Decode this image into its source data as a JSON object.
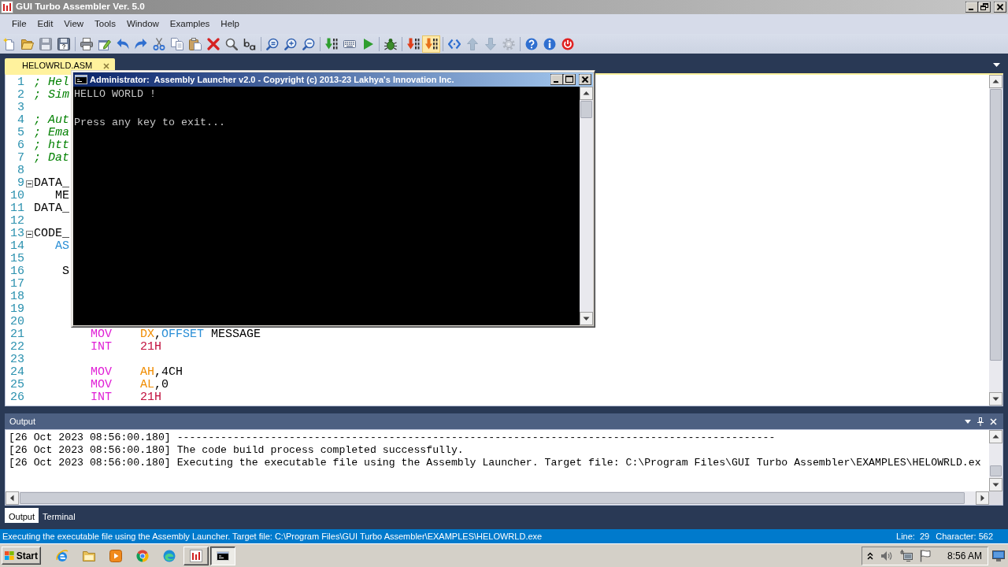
{
  "window": {
    "title": "GUI Turbo Assembler Ver. 5.0"
  },
  "menu": [
    "File",
    "Edit",
    "View",
    "Tools",
    "Window",
    "Examples",
    "Help"
  ],
  "toolbar": [
    [
      {
        "kind": "new",
        "disabled": false,
        "pressed": false
      },
      {
        "kind": "open",
        "disabled": false,
        "pressed": false
      },
      {
        "kind": "save",
        "disabled": true,
        "pressed": false
      },
      {
        "kind": "saveall",
        "disabled": false,
        "pressed": false
      }
    ],
    [
      {
        "kind": "print",
        "disabled": false,
        "pressed": false
      },
      {
        "kind": "publish",
        "disabled": false,
        "pressed": false
      },
      {
        "kind": "undo",
        "disabled": false,
        "pressed": false
      },
      {
        "kind": "redo",
        "disabled": false,
        "pressed": false
      },
      {
        "kind": "cut",
        "disabled": false,
        "pressed": false
      },
      {
        "kind": "copy",
        "disabled": false,
        "pressed": false
      },
      {
        "kind": "paste",
        "disabled": false,
        "pressed": false
      },
      {
        "kind": "delete",
        "disabled": false,
        "pressed": false
      },
      {
        "kind": "find",
        "disabled": false,
        "pressed": false
      },
      {
        "kind": "replace",
        "disabled": false,
        "pressed": false
      }
    ],
    [
      {
        "kind": "zoom",
        "disabled": false,
        "pressed": false
      },
      {
        "kind": "zoomin",
        "disabled": false,
        "pressed": false
      },
      {
        "kind": "zoomout",
        "disabled": false,
        "pressed": false
      }
    ],
    [
      {
        "kind": "build",
        "disabled": false,
        "pressed": false
      },
      {
        "kind": "keyboard",
        "disabled": false,
        "pressed": false
      },
      {
        "kind": "run",
        "disabled": false,
        "pressed": false
      }
    ],
    [
      {
        "kind": "debug",
        "disabled": false,
        "pressed": false
      }
    ],
    [
      {
        "kind": "assemble",
        "disabled": false,
        "pressed": false
      },
      {
        "kind": "link",
        "disabled": false,
        "pressed": true
      }
    ],
    [
      {
        "kind": "code",
        "disabled": false,
        "pressed": false
      },
      {
        "kind": "up",
        "disabled": true,
        "pressed": false
      },
      {
        "kind": "down",
        "disabled": true,
        "pressed": false
      },
      {
        "kind": "settings",
        "disabled": true,
        "pressed": false
      }
    ],
    [
      {
        "kind": "help",
        "disabled": false,
        "pressed": false
      },
      {
        "kind": "info",
        "disabled": false,
        "pressed": false
      },
      {
        "kind": "power",
        "disabled": false,
        "pressed": false
      }
    ]
  ],
  "document_tabs": [
    {
      "label": "HELOWRLD.ASM",
      "selected": true
    }
  ],
  "editor": {
    "lines": [
      {
        "number": "1",
        "segments": [
          {
            "text": "; Hel",
            "kind": "comment"
          }
        ]
      },
      {
        "number": "2",
        "segments": [
          {
            "text": "; Sim",
            "kind": "comment"
          }
        ]
      },
      {
        "number": "3"
      },
      {
        "number": "4",
        "segments": [
          {
            "text": "; Aut",
            "kind": "comment"
          }
        ]
      },
      {
        "number": "5",
        "segments": [
          {
            "text": "; Ema",
            "kind": "comment"
          }
        ]
      },
      {
        "number": "6",
        "segments": [
          {
            "text": "; htt",
            "kind": "comment"
          }
        ]
      },
      {
        "number": "7",
        "segments": [
          {
            "text": "; Dat",
            "kind": "comment"
          }
        ]
      },
      {
        "number": "8"
      },
      {
        "number": "9",
        "expanded": true,
        "segments": [
          {
            "text": "DATA_",
            "kind": "plain"
          }
        ]
      },
      {
        "number": "10",
        "segments": [
          {
            "text": "   ME",
            "kind": "plain"
          }
        ]
      },
      {
        "number": "11",
        "segments": [
          {
            "text": "DATA_",
            "kind": "plain"
          }
        ]
      },
      {
        "number": "12"
      },
      {
        "number": "13",
        "expanded": true,
        "segments": [
          {
            "text": "CODE_",
            "kind": "plain"
          }
        ]
      },
      {
        "number": "14",
        "segments": [
          {
            "text": "   AS",
            "kind": "directive"
          }
        ]
      },
      {
        "number": "15"
      },
      {
        "number": "16",
        "segments": [
          {
            "text": "    S",
            "kind": "plain"
          }
        ]
      },
      {
        "number": "17"
      },
      {
        "number": "18"
      },
      {
        "number": "19"
      },
      {
        "number": "20"
      },
      {
        "number": "21",
        "segments": [
          {
            "text": "        MOV",
            "kind": "instruction"
          },
          {
            "text": "    DX",
            "kind": "register"
          },
          {
            "text": ",",
            "kind": "plain"
          },
          {
            "text": "OFFSET",
            "kind": "directive"
          },
          {
            "text": " MESSAGE",
            "kind": "plain"
          }
        ]
      },
      {
        "number": "22",
        "segments": [
          {
            "text": "        INT",
            "kind": "instruction"
          },
          {
            "text": "    21H",
            "kind": "number"
          }
        ]
      },
      {
        "number": "23"
      },
      {
        "number": "24",
        "segments": [
          {
            "text": "        MOV",
            "kind": "instruction"
          },
          {
            "text": "    AH",
            "kind": "register"
          },
          {
            "text": ",4CH",
            "kind": "plain"
          }
        ]
      },
      {
        "number": "25",
        "segments": [
          {
            "text": "        MOV",
            "kind": "instruction"
          },
          {
            "text": "    AL",
            "kind": "register"
          },
          {
            "text": ",0",
            "kind": "plain"
          }
        ]
      },
      {
        "number": "26",
        "segments": [
          {
            "text": "        INT",
            "kind": "instruction"
          },
          {
            "text": "    21H",
            "kind": "number"
          }
        ]
      }
    ]
  },
  "console": {
    "title": "Administrator:  Assembly Launcher v2.0 - Copyright (c) 2013-23 Lakhya's Innovation Inc.",
    "output": "HELLO WORLD !",
    "prompt": "Press any key to exit..."
  },
  "output_panel": {
    "title": "Output",
    "lines": [
      "[26 Oct 2023 08:56:00.180] ------------------------------------------------------------------------------------------------",
      "[26 Oct 2023 08:56:00.180] The code build process completed successfully.",
      "[26 Oct 2023 08:56:00.180] Executing the executable file using the Assembly Launcher. Target file: C:\\Program Files\\GUI Turbo Assembler\\EXAMPLES\\HELOWRLD.ex"
    ],
    "tabs": [
      {
        "label": "Output",
        "selected": true
      },
      {
        "label": "Terminal",
        "selected": false
      }
    ]
  },
  "status_bar": {
    "message": "Executing the executable file using the Assembly Launcher. Target file: C:\\Program Files\\GUI Turbo Assembler\\EXAMPLES\\HELOWRLD.exe",
    "line": "Line:  29",
    "character": "Character: 562"
  },
  "taskbar": {
    "start": "Start",
    "quick_launch": [
      {
        "kind": "ie"
      },
      {
        "kind": "folder"
      },
      {
        "kind": "player"
      },
      {
        "kind": "chrome"
      },
      {
        "kind": "edge"
      }
    ],
    "tasks": [
      {
        "kind": "assembler",
        "selected": false
      },
      {
        "kind": "console",
        "selected": true
      }
    ],
    "tray": [
      {
        "kind": "expand"
      },
      {
        "kind": "volume"
      },
      {
        "kind": "network"
      },
      {
        "kind": "flag"
      }
    ],
    "clock": "8:56 AM"
  }
}
